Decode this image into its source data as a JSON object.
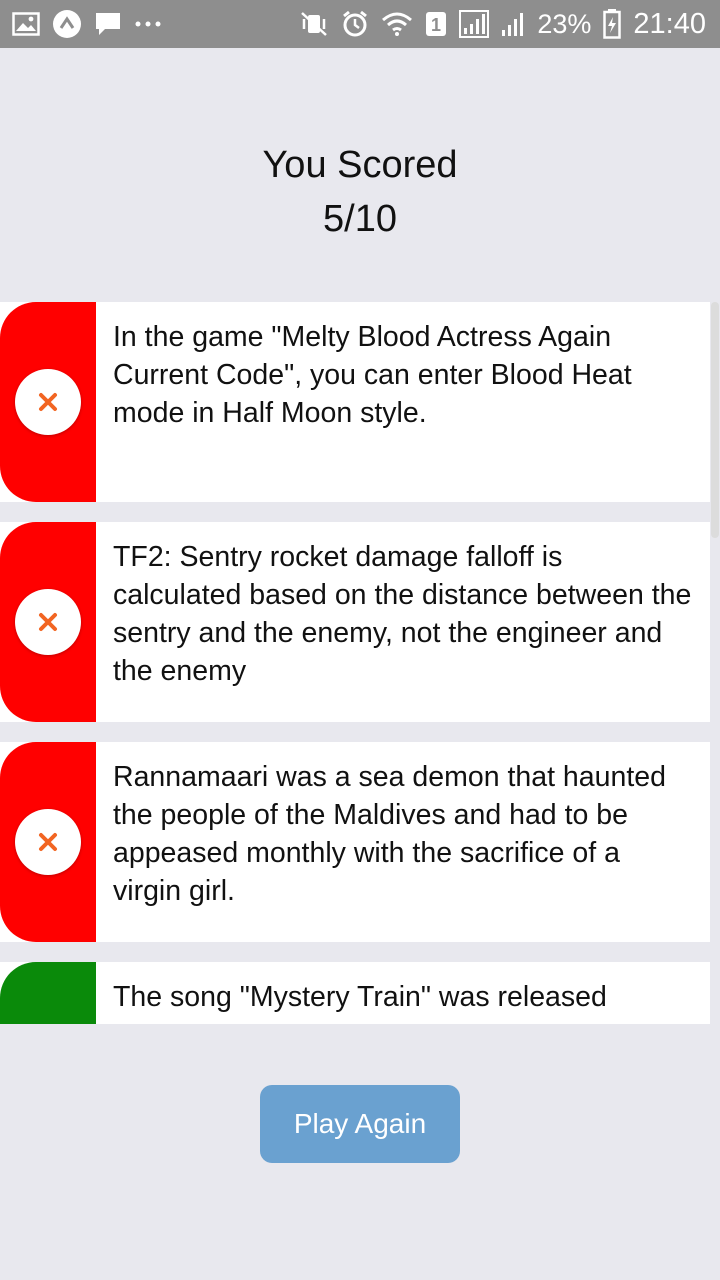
{
  "status_bar": {
    "battery_percent": "23%",
    "time": "21:40",
    "sim_badge": "1",
    "icons": [
      "gallery-icon",
      "expo-icon",
      "message-icon",
      "more-dots-icon",
      "vibrate-mute-icon",
      "alarm-icon",
      "wifi-icon",
      "signal-icon",
      "signal-icon",
      "battery-icon"
    ]
  },
  "score": {
    "title": "You Scored",
    "value": "5/10"
  },
  "colors": {
    "wrong": "#ff0000",
    "correct": "#0a8a0a",
    "cross": "#f26522",
    "button": "#6aa1d0"
  },
  "results": [
    {
      "status": "wrong",
      "icon": "close-icon",
      "text": "In the game \"Melty Blood Actress Again Current Code\", you can enter Blood Heat mode in Half Moon style."
    },
    {
      "status": "wrong",
      "icon": "close-icon",
      "text": "TF2: Sentry rocket damage falloff is calculated based on the distance between the sentry and the enemy, not the engineer and the enemy"
    },
    {
      "status": "wrong",
      "icon": "close-icon",
      "text": "Rannamaari was a sea demon that haunted the people of the Maldives and had to be appeased monthly with the sacrifice of a virgin girl."
    },
    {
      "status": "correct",
      "text": "The song \"Mystery Train\" was released"
    }
  ],
  "actions": {
    "play_again": "Play Again"
  }
}
